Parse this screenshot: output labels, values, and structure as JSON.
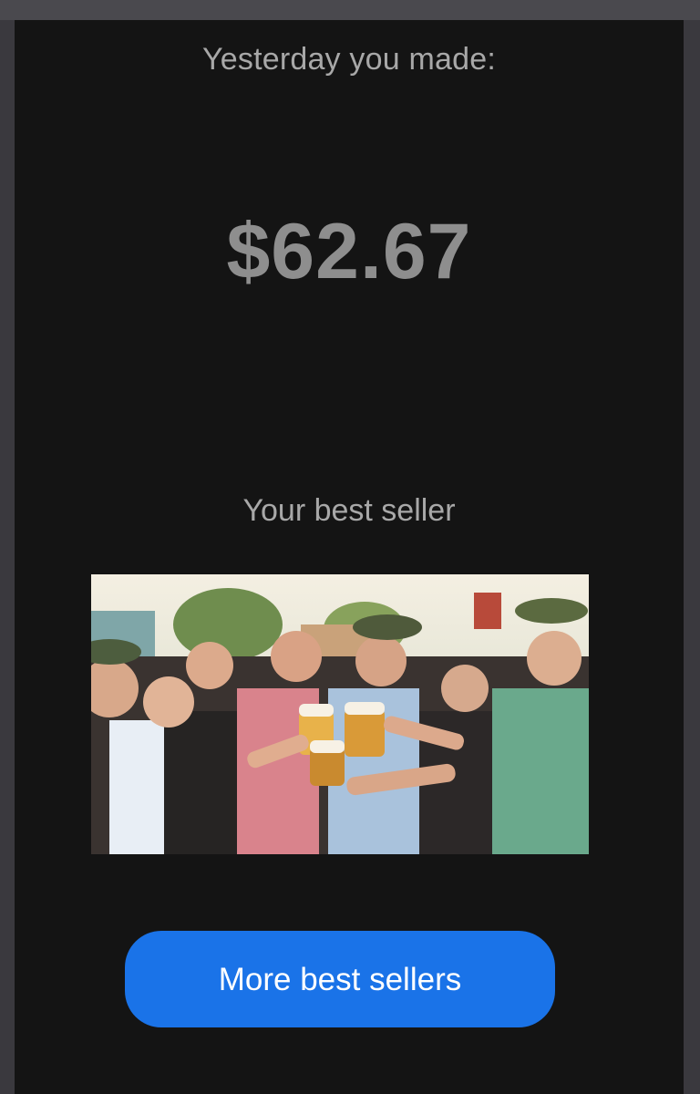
{
  "summary": {
    "heading": "Yesterday you made:",
    "amount": "$62.67"
  },
  "best_seller": {
    "heading": "Your best seller",
    "image_icon": "group-toasting-photo"
  },
  "actions": {
    "more_label": "More best sellers"
  },
  "colors": {
    "background": "#141414",
    "text": "#a8a8a8",
    "amount": "#8e8e8e",
    "button": "#1a73e8",
    "button_text": "#ffffff"
  }
}
